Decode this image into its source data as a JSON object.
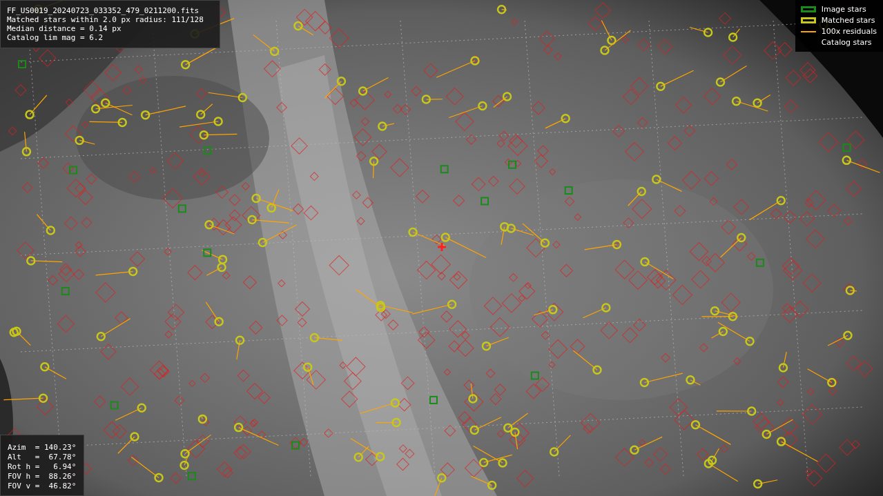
{
  "info_box": {
    "lines": [
      "FF_US0019_20240723_033352_479_0211200.fits",
      "Matched stars within 2.0 px radius: 111/128",
      "Median distance = 0.14 px",
      "Catalog lim mag = 6.2"
    ]
  },
  "legend": [
    {
      "label": "Image stars",
      "color": "#1a8a1a"
    },
    {
      "kind": "matched",
      "label": "Matched stars",
      "color": "#c8c81a"
    },
    {
      "kind": "residual",
      "label": "100x residuals",
      "color": "#ffa500"
    },
    {
      "kind": "catalog",
      "label": "Catalog stars"
    }
  ],
  "pointing_box": {
    "lines": [
      "Azim  = 140.23°",
      "Alt   =  67.78°",
      "Rot h =   6.94°",
      "FOV h =  88.26°",
      "FOV v =  46.82°"
    ]
  }
}
